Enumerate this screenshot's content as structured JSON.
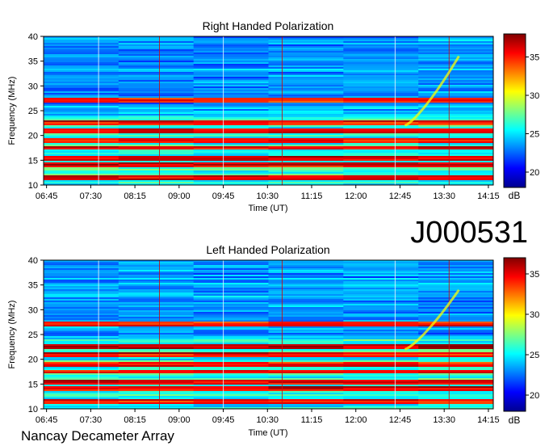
{
  "title_id": "J000531",
  "footer": "Nancay Decameter Array",
  "chart_data": [
    {
      "type": "heatmap",
      "title": "Right Handed Polarization",
      "xlabel": "Time (UT)",
      "ylabel": "Frequency (MHz)",
      "x_ticks": [
        "06:45",
        "07:30",
        "08:15",
        "09:00",
        "09:45",
        "10:30",
        "11:15",
        "12:00",
        "12:45",
        "13:30",
        "14:15"
      ],
      "y_ticks": [
        10,
        15,
        20,
        25,
        30,
        35,
        40
      ],
      "ylim": [
        10,
        40
      ],
      "colorbar": {
        "label": "dB",
        "ticks": [
          20,
          25,
          30,
          35
        ],
        "range": [
          18,
          38
        ]
      },
      "bands_mhz": [
        11.5,
        14,
        15.5,
        17.5,
        19,
        21,
        22.5,
        27.2
      ],
      "vertical_lines_ut": [
        "07:38",
        "08:40",
        "09:45",
        "10:45",
        "12:40",
        "13:35",
        "14:20"
      ],
      "burst": {
        "start_ut": "12:50",
        "end_ut": "13:45",
        "freq_mhz": [
          22,
          36
        ]
      }
    },
    {
      "type": "heatmap",
      "title": "Left Handed Polarization",
      "xlabel": "Time (UT)",
      "ylabel": "Frequency (MHz)",
      "x_ticks": [
        "06:45",
        "07:30",
        "08:15",
        "09:00",
        "09:45",
        "10:30",
        "11:15",
        "12:00",
        "12:45",
        "13:30",
        "14:15"
      ],
      "y_ticks": [
        10,
        15,
        20,
        25,
        30,
        35,
        40
      ],
      "ylim": [
        10,
        40
      ],
      "colorbar": {
        "label": "dB",
        "ticks": [
          20,
          25,
          30,
          35
        ],
        "range": [
          18,
          37
        ]
      },
      "bands_mhz": [
        11.5,
        14,
        15.5,
        17.5,
        19,
        21,
        22.5,
        27.2
      ],
      "vertical_lines_ut": [
        "07:38",
        "08:40",
        "09:45",
        "10:45",
        "12:40",
        "13:35",
        "14:20"
      ],
      "burst": {
        "start_ut": "12:50",
        "end_ut": "13:45",
        "freq_mhz": [
          22,
          34
        ]
      }
    }
  ]
}
